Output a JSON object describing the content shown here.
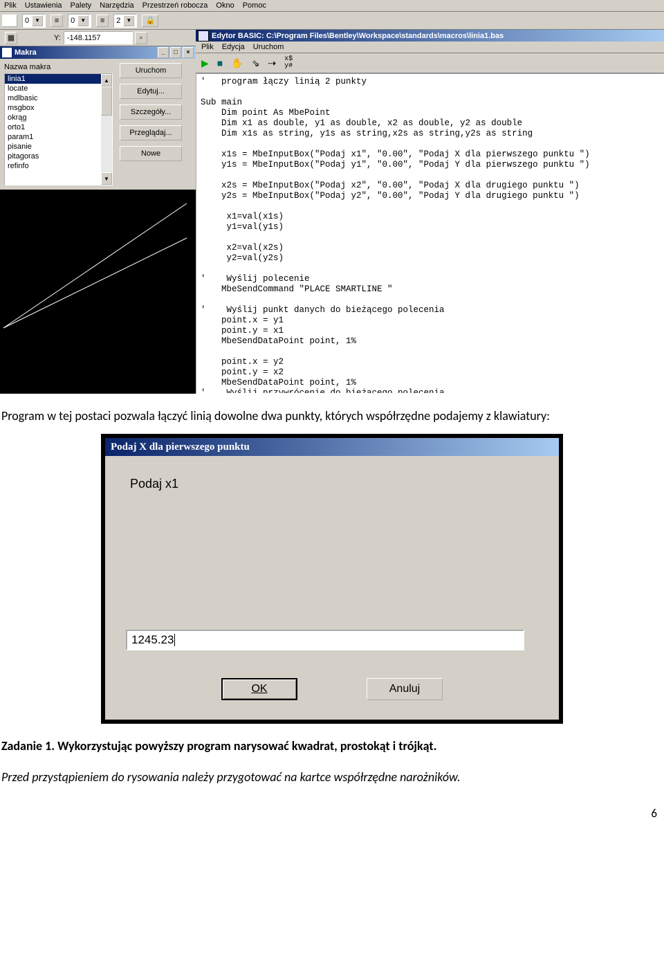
{
  "main_menu": [
    "Plik",
    "Ustawienia",
    "Palety",
    "Narzędzia",
    "Przestrzeń robocza",
    "Okno",
    "Pomoc"
  ],
  "toolbar": {
    "drop0": "0",
    "drop1": "0",
    "drop2": "2"
  },
  "coord": {
    "label": "Y:",
    "value": "-148.1157"
  },
  "makra_win": {
    "title": "Makra",
    "label": "Nazwa makra",
    "items": [
      "linia1",
      "locate",
      "mdlbasic",
      "msgbox",
      "okrąg",
      "orto1",
      "param1",
      "pisanie",
      "pitagoras",
      "refinfo"
    ],
    "selected": 0,
    "buttons": [
      "Uruchom",
      "Edytuj...",
      "Szczegóły...",
      "Przeglądaj...",
      "Nowe"
    ]
  },
  "editor": {
    "title": "Edytor BASIC: C:\\Program Files\\Bentley\\Workspace\\standards\\macros\\linia1.bas",
    "menu": [
      "Plik",
      "Edycja",
      "Uruchom"
    ],
    "tb_icons": [
      "▶",
      "■",
      "✋",
      "↗",
      "↘",
      "x$\\ny#"
    ],
    "code": "'   program łączy linią 2 punkty\n\nSub main\n    Dim point As MbePoint\n    Dim x1 as double, y1 as double, x2 as double, y2 as double\n    Dim x1s as string, y1s as string,x2s as string,y2s as string\n\n    x1s = MbeInputBox(\"Podaj x1\", \"0.00\", \"Podaj X dla pierwszego punktu \")\n    y1s = MbeInputBox(\"Podaj y1\", \"0.00\", \"Podaj Y dla pierwszego punktu \")\n\n    x2s = MbeInputBox(\"Podaj x2\", \"0.00\", \"Podaj X dla drugiego punktu \")\n    y2s = MbeInputBox(\"Podaj y2\", \"0.00\", \"Podaj Y dla drugiego punktu \")\n\n     x1=val(x1s)\n     y1=val(y1s)\n\n     x2=val(x2s)\n     y2=val(y2s)\n\n'    Wyślij polecenie\n    MbeSendCommand \"PLACE SMARTLINE \"\n\n'    Wyślij punkt danych do bieżącego polecenia\n    point.x = y1\n    point.y = x1\n    MbeSendDataPoint point, 1%\n\n    point.x = y2\n    point.y = x2\n    MbeSendDataPoint point, 1%\n'    Wyślij przywrócenie do bieżącego polecenia\n    MbeSendReset\nEnd Sub"
  },
  "para1": "Program w tej postaci pozwala łączyć linią dowolne dwa punkty, których współrzędne podajemy z klawiatury:",
  "dialog": {
    "title": "Podaj X dla pierwszego punktu",
    "prompt": "Podaj x1",
    "value": "1245.23",
    "ok": "OK",
    "cancel": "Anuluj"
  },
  "para2": "Zadanie 1. Wykorzystując powyższy program narysować kwadrat, prostokąt i trójkąt.",
  "para3": "Przed przystąpieniem do rysowania należy przygotować na kartce współrzędne narożników.",
  "page_number": "6"
}
